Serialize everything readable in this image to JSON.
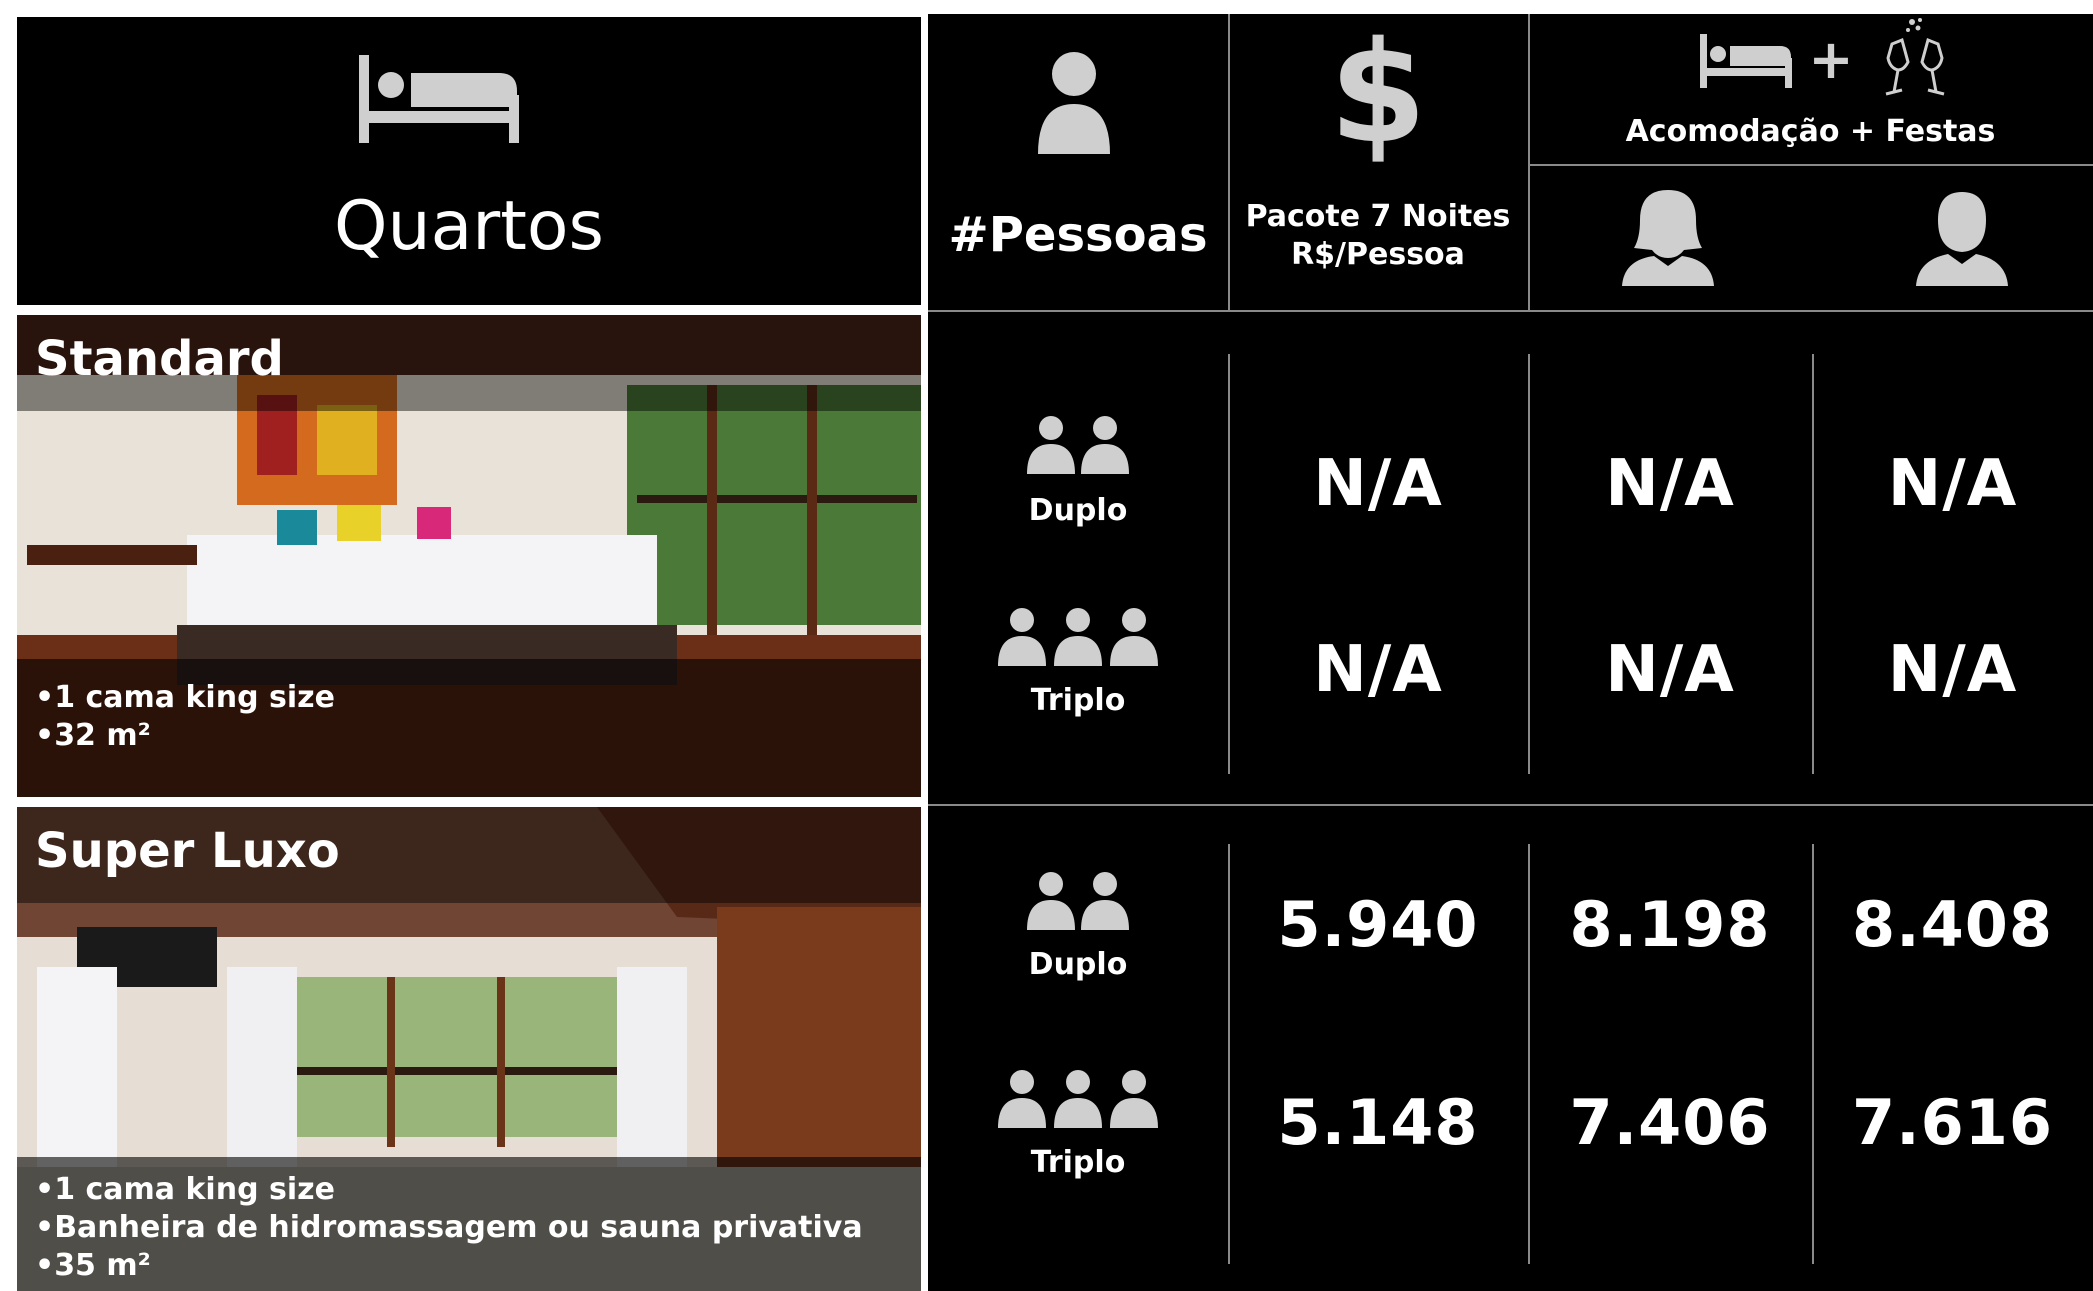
{
  "header": {
    "rooms_title": "Quartos",
    "people_label": "#Pessoas",
    "package_label_line1": "Pacote 7 Noites",
    "package_label_line2": "R$/Pessoa",
    "combo_label": "Acomodação + Festas",
    "dollar_symbol": "$",
    "plus_symbol": "+"
  },
  "icons": {
    "bed": "bed-icon",
    "person": "person-icon",
    "dollar": "dollar-icon",
    "champagne": "champagne-glasses-icon",
    "female": "female-user-icon",
    "male": "male-user-icon",
    "group": "people-group-icon"
  },
  "colors": {
    "background": "#000000",
    "border": "#ffffff",
    "icon": "#cfcfcf",
    "divider": "#8a8a8a"
  },
  "rooms": [
    {
      "name": "Standard",
      "features": [
        "1 cama king size",
        "32 m²"
      ],
      "rows": [
        {
          "occupancy": "Duplo",
          "package": "N/A",
          "female": "N/A",
          "male": "N/A"
        },
        {
          "occupancy": "Triplo",
          "package": "N/A",
          "female": "N/A",
          "male": "N/A"
        }
      ]
    },
    {
      "name": "Super Luxo",
      "features": [
        "1 cama king size",
        "Banheira de hidromassagem ou sauna privativa",
        "35 m²"
      ],
      "rows": [
        {
          "occupancy": "Duplo",
          "package": "5.940",
          "female": "8.198",
          "male": "8.408"
        },
        {
          "occupancy": "Triplo",
          "package": "5.148",
          "female": "7.406",
          "male": "7.616"
        }
      ]
    }
  ]
}
